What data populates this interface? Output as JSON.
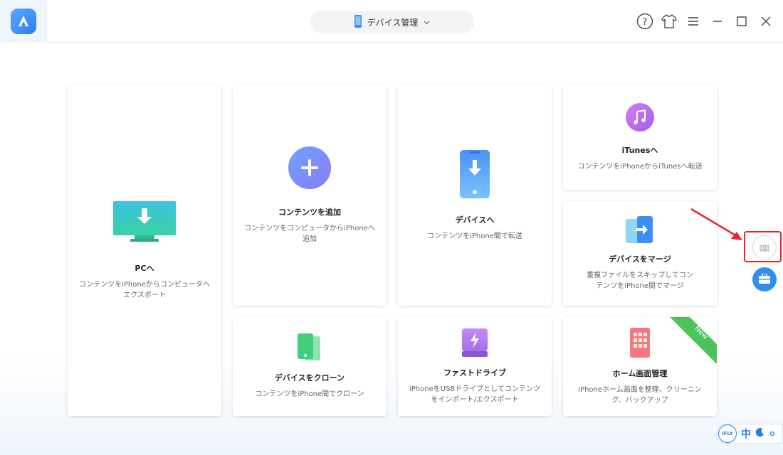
{
  "header": {
    "device_label": "デバイス管理"
  },
  "cards": {
    "pc": {
      "title": "PCへ",
      "desc": "コンテンツをiPhoneからコンピュータへエクスポート"
    },
    "add": {
      "title": "コンテンツを追加",
      "desc": "コンテンツをコンピュータからiPhoneへ追加"
    },
    "device": {
      "title": "デバイスへ",
      "desc": "コンテンツをiPhone間で転送"
    },
    "itunes": {
      "title": "iTunesへ",
      "desc": "コンテンツをiPhoneからiTunesへ転送"
    },
    "merge": {
      "title": "デバイスをマージ",
      "desc": "重複ファイルをスキップしてコンテンツをiPhone間でマージ"
    },
    "clone": {
      "title": "デバイスをクローン",
      "desc": "コンテンツをiPhone間でクローン"
    },
    "drive": {
      "title": "ファストドライブ",
      "desc": "iPhoneをUSBドライブとしてコンテンツをインポート/エクスポート"
    },
    "home": {
      "title": "ホーム画面管理",
      "desc": "iPhoneホーム画面を整理、クリーニング、バックアップ",
      "ribbon": "New"
    }
  },
  "ime": {
    "badge": "iFLY",
    "lang": "中"
  },
  "icons": [
    "app-logo-icon",
    "phone-icon",
    "chevron-down-icon",
    "help-icon",
    "skin-icon",
    "menu-icon",
    "minimize-icon",
    "maximize-icon",
    "close-icon",
    "monitor-download-icon",
    "plus-icon",
    "phone-download-icon",
    "music-icon",
    "merge-icon",
    "clone-icon",
    "fast-drive-icon",
    "home-screen-icon",
    "grid-icon",
    "toolbox-icon",
    "arrow-icon"
  ],
  "colors": {
    "accent": "#3d8ef0",
    "highlight": "#e8242b",
    "ribbon": "#4cc45a"
  }
}
